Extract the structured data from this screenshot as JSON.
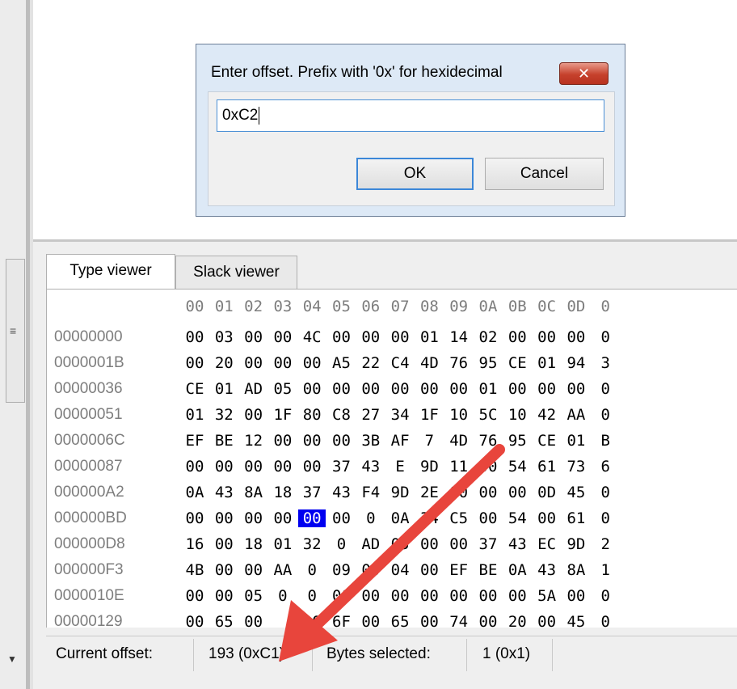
{
  "dialog": {
    "title": "Enter offset. Prefix with '0x' for hexidecimal",
    "close_label": "✕",
    "input_value": "0xC2",
    "ok_label": "OK",
    "cancel_label": "Cancel"
  },
  "tabs": [
    {
      "label": "Type viewer",
      "active": true
    },
    {
      "label": "Slack viewer",
      "active": false
    }
  ],
  "hex": {
    "columns": [
      "00",
      "01",
      "02",
      "03",
      "04",
      "05",
      "06",
      "07",
      "08",
      "09",
      "0A",
      "0B",
      "0C",
      "0D",
      "0"
    ],
    "rows": [
      {
        "offset": "00000000",
        "bytes": [
          "00",
          "03",
          "00",
          "00",
          "4C",
          "00",
          "00",
          "00",
          "01",
          "14",
          "02",
          "00",
          "00",
          "00",
          "0"
        ]
      },
      {
        "offset": "0000001B",
        "bytes": [
          "00",
          "20",
          "00",
          "00",
          "00",
          "A5",
          "22",
          "C4",
          "4D",
          "76",
          "95",
          "CE",
          "01",
          "94",
          "3"
        ]
      },
      {
        "offset": "00000036",
        "bytes": [
          "CE",
          "01",
          "AD",
          "05",
          "00",
          "00",
          "00",
          "00",
          "00",
          "00",
          "01",
          "00",
          "00",
          "00",
          "0"
        ]
      },
      {
        "offset": "00000051",
        "bytes": [
          "01",
          "32",
          "00",
          "1F",
          "80",
          "C8",
          "27",
          "34",
          "1F",
          "10",
          "5C",
          "10",
          "42",
          "AA",
          "0"
        ]
      },
      {
        "offset": "0000006C",
        "bytes": [
          "EF",
          "BE",
          "12",
          "00",
          "00",
          "00",
          "3B",
          "AF",
          "7",
          "4D",
          "76",
          "95",
          "CE",
          "01",
          "B"
        ]
      },
      {
        "offset": "00000087",
        "bytes": [
          "00",
          "00",
          "00",
          "00",
          "00",
          "37",
          "43",
          "E",
          "9D",
          "11",
          "00",
          "54",
          "61",
          "73",
          "6"
        ]
      },
      {
        "offset": "000000A2",
        "bytes": [
          "0A",
          "43",
          "8A",
          "18",
          "37",
          "43",
          "F4",
          "9D",
          "2E",
          "00",
          "00",
          "00",
          "0D",
          "45",
          "0"
        ]
      },
      {
        "offset": "000000BD",
        "bytes": [
          "00",
          "00",
          "00",
          "00",
          "00",
          "00",
          "0",
          "0A",
          "34",
          "C5",
          "00",
          "54",
          "00",
          "61",
          "0"
        ]
      },
      {
        "offset": "000000D8",
        "bytes": [
          "16",
          "00",
          "18",
          "01",
          "32",
          "0",
          "AD",
          "05",
          "00",
          "00",
          "37",
          "43",
          "EC",
          "9D",
          "2"
        ]
      },
      {
        "offset": "000000F3",
        "bytes": [
          "4B",
          "00",
          "00",
          "AA",
          "0",
          "09",
          "00",
          "04",
          "00",
          "EF",
          "BE",
          "0A",
          "43",
          "8A",
          "1"
        ]
      },
      {
        "offset": "0000010E",
        "bytes": [
          "00",
          "00",
          "05",
          "0",
          "0",
          "00",
          "00",
          "00",
          "00",
          "00",
          "00",
          "00",
          "5A",
          "00",
          "0"
        ]
      },
      {
        "offset": "00000129",
        "bytes": [
          "00",
          "65",
          "00",
          "",
          "00",
          "6F",
          "00",
          "65",
          "00",
          "74",
          "00",
          "20",
          "00",
          "45",
          "0"
        ]
      }
    ],
    "selected": {
      "row": 7,
      "col": 4
    }
  },
  "status": {
    "current_offset_label": "Current offset:",
    "current_offset_value": "193 (0xC1)",
    "bytes_selected_label": "Bytes selected:",
    "bytes_selected_value": "1 (0x1)"
  },
  "annotation": {
    "arrow_color": "#e8453c"
  }
}
